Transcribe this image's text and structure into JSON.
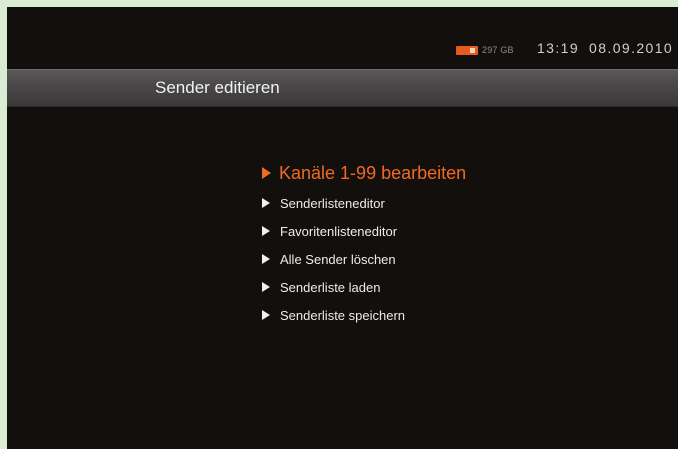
{
  "status": {
    "hdd_icon": "hdd-icon",
    "hdd_free": "297 GB",
    "time": "13:19",
    "date": "08.09.2010"
  },
  "header": {
    "title": "Sender editieren"
  },
  "menu": {
    "selected_index": 0,
    "items": [
      {
        "label": "Kanäle 1-99 bearbeiten"
      },
      {
        "label": "Senderlisteneditor"
      },
      {
        "label": "Favoritenlisteneditor"
      },
      {
        "label": "Alle Sender löschen"
      },
      {
        "label": "Senderliste laden"
      },
      {
        "label": "Senderliste speichern"
      }
    ]
  },
  "colors": {
    "background": "#130f0c",
    "accent": "#f06a26",
    "text": "#ececec"
  }
}
